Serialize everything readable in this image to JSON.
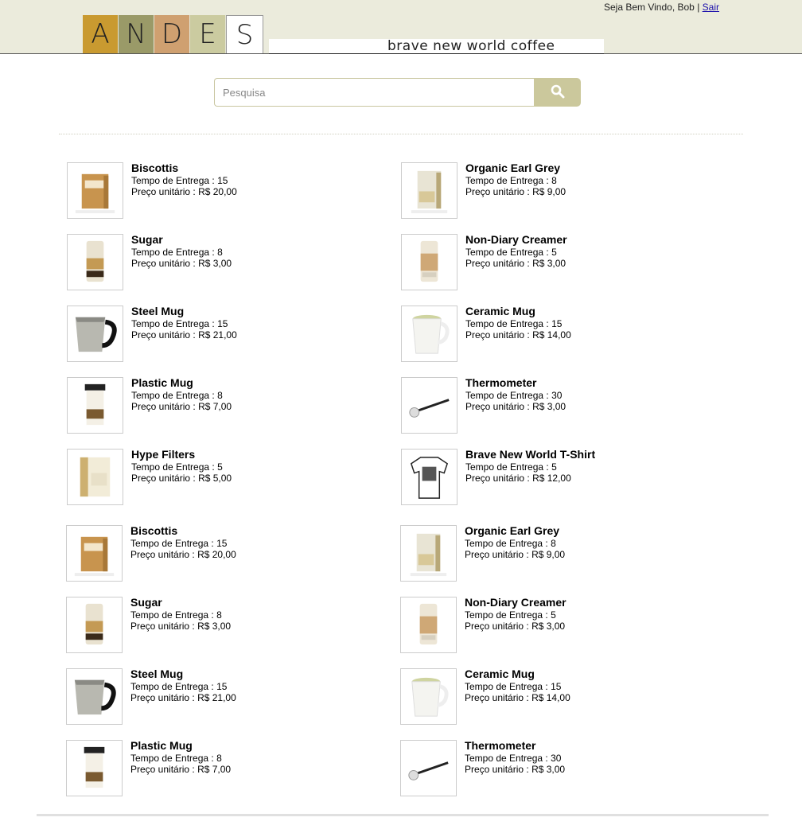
{
  "brand": {
    "letters": [
      "A",
      "N",
      "D",
      "E",
      "S"
    ],
    "tile_colors": [
      "#c99a30",
      "#9a9a68",
      "#cfa070",
      "#cbcba0",
      "#ffffff"
    ],
    "tagline": "brave new world coffee"
  },
  "user": {
    "welcome": "Seja Bem Vindo, Bob",
    "separator": "|",
    "logout": "Sair"
  },
  "search": {
    "placeholder": "Pesquisa",
    "icon": "search-icon"
  },
  "labels": {
    "delivery": "Tempo de Entrega :",
    "price": "Preço unitário :"
  },
  "products": [
    {
      "name": "Biscottis",
      "delivery": "15",
      "price": "R$ 20,00",
      "image": "biscotti-box"
    },
    {
      "name": "Organic Earl Grey",
      "delivery": "8",
      "price": "R$ 9,00",
      "image": "tea-box"
    },
    {
      "name": "Sugar",
      "delivery": "8",
      "price": "R$ 3,00",
      "image": "sugar-canister"
    },
    {
      "name": "Non-Diary Creamer",
      "delivery": "5",
      "price": "R$ 3,00",
      "image": "creamer-canister"
    },
    {
      "name": "Steel Mug",
      "delivery": "15",
      "price": "R$ 21,00",
      "image": "steel-mug"
    },
    {
      "name": "Ceramic Mug",
      "delivery": "15",
      "price": "R$ 14,00",
      "image": "ceramic-mug"
    },
    {
      "name": "Plastic Mug",
      "delivery": "8",
      "price": "R$ 7,00",
      "image": "plastic-mug"
    },
    {
      "name": "Thermometer",
      "delivery": "30",
      "price": "R$ 3,00",
      "image": "thermometer"
    },
    {
      "name": "Hype Filters",
      "delivery": "5",
      "price": "R$ 5,00",
      "image": "filters-box"
    },
    {
      "name": "Brave New World T-Shirt",
      "delivery": "5",
      "price": "R$ 12,00",
      "image": "t-shirt"
    },
    {
      "name": "Biscottis",
      "delivery": "15",
      "price": "R$ 20,00",
      "image": "biscotti-box"
    },
    {
      "name": "Organic Earl Grey",
      "delivery": "8",
      "price": "R$ 9,00",
      "image": "tea-box"
    },
    {
      "name": "Sugar",
      "delivery": "8",
      "price": "R$ 3,00",
      "image": "sugar-canister"
    },
    {
      "name": "Non-Diary Creamer",
      "delivery": "5",
      "price": "R$ 3,00",
      "image": "creamer-canister"
    },
    {
      "name": "Steel Mug",
      "delivery": "15",
      "price": "R$ 21,00",
      "image": "steel-mug"
    },
    {
      "name": "Ceramic Mug",
      "delivery": "15",
      "price": "R$ 14,00",
      "image": "ceramic-mug"
    },
    {
      "name": "Plastic Mug",
      "delivery": "8",
      "price": "R$ 7,00",
      "image": "plastic-mug"
    },
    {
      "name": "Thermometer",
      "delivery": "30",
      "price": "R$ 3,00",
      "image": "thermometer"
    }
  ]
}
